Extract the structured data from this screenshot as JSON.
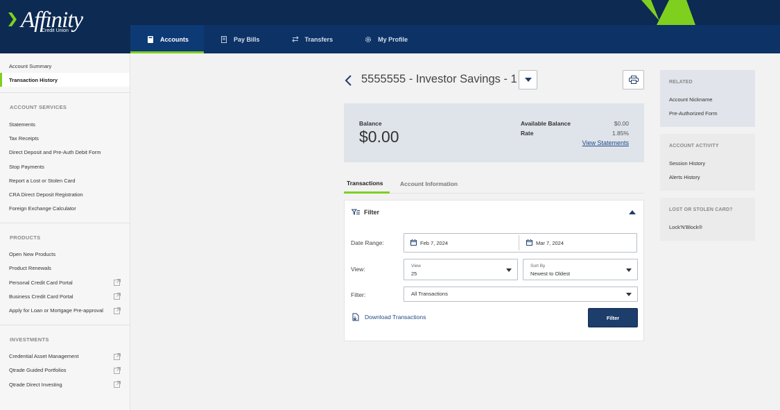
{
  "brand": {
    "name": "Affinity",
    "sub": "Credit Union",
    "accent": "#7fcf1f",
    "navy": "#0c2a52"
  },
  "nav": [
    {
      "label": "Accounts",
      "icon": "wallet-icon",
      "active": true
    },
    {
      "label": "Pay Bills",
      "icon": "bill-icon",
      "active": false
    },
    {
      "label": "Transfers",
      "icon": "transfer-icon",
      "active": false
    },
    {
      "label": "My Profile",
      "icon": "gear-icon",
      "active": false
    }
  ],
  "sidebar": {
    "top": [
      {
        "label": "Account Summary",
        "active": false
      },
      {
        "label": "Transaction History",
        "active": true
      }
    ],
    "sections": [
      {
        "heading": "Account Services",
        "items": [
          {
            "label": "Statements",
            "external": false
          },
          {
            "label": "Tax Receipts",
            "external": false
          },
          {
            "label": "Direct Deposit and Pre-Auth Debit Form",
            "external": false
          },
          {
            "label": "Stop Payments",
            "external": false
          },
          {
            "label": "Report a Lost or Stolen Card",
            "external": false
          },
          {
            "label": "CRA Direct Deposit Registration",
            "external": false
          },
          {
            "label": "Foreign Exchange Calculator",
            "external": false
          }
        ]
      },
      {
        "heading": "Products",
        "items": [
          {
            "label": "Open New Products",
            "external": false
          },
          {
            "label": "Product Renewals",
            "external": false
          },
          {
            "label": "Personal Credit Card Portal",
            "external": true
          },
          {
            "label": "Business Credit Card Portal",
            "external": true
          },
          {
            "label": "Apply for Loan or Mortgage Pre-approval",
            "external": true
          }
        ]
      },
      {
        "heading": "Investments",
        "items": [
          {
            "label": "Credential Asset Management",
            "external": true
          },
          {
            "label": "Qtrade Guided Portfolios",
            "external": true
          },
          {
            "label": "Qtrade Direct Investing",
            "external": true
          }
        ]
      }
    ]
  },
  "account": {
    "title": "5555555 - Investor Savings - 1",
    "balance_label": "Balance",
    "balance_value": "$0.00",
    "available_label": "Available Balance",
    "available_value": "$0.00",
    "rate_label": "Rate",
    "rate_value": "1.85%",
    "view_statements": "View Statements"
  },
  "tabs": [
    {
      "label": "Transactions",
      "active": true
    },
    {
      "label": "Account Information",
      "active": false
    }
  ],
  "filter": {
    "heading": "Filter",
    "date_range_label": "Date Range:",
    "date_from": "Feb 7, 2024",
    "date_to": "Mar 7, 2024",
    "view_label": "View:",
    "view_small": "View",
    "view_value": "25",
    "sort_small": "Sort By",
    "sort_value": "Newest to Oldest",
    "filter_label": "Filter:",
    "filter_value": "All Transactions",
    "download_label": "Download Transactions",
    "button_label": "Filter"
  },
  "right": {
    "related": {
      "heading": "Related",
      "items": [
        "Account Nickname",
        "Pre-Authorized Form"
      ]
    },
    "activity": {
      "heading": "Account Activity",
      "items": [
        "Session History",
        "Alerts History"
      ]
    },
    "lost": {
      "heading": "Lost or Stolen Card?",
      "items": [
        "Lock'N'Block®"
      ]
    }
  }
}
